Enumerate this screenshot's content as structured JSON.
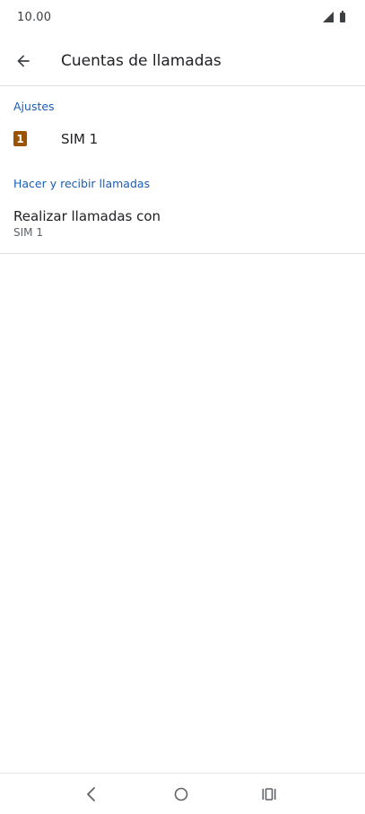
{
  "status_bar": {
    "time": "10.00",
    "icons": [
      "signal-icon",
      "battery-icon"
    ]
  },
  "app_bar": {
    "back_icon": "arrow-left-icon",
    "title": "Cuentas de llamadas"
  },
  "sections": [
    {
      "header": "Ajustes",
      "items": [
        {
          "badge": "1",
          "title": "SIM 1"
        }
      ]
    },
    {
      "header": "Hacer y recibir llamadas",
      "items": [
        {
          "title": "Realizar llamadas con",
          "subtitle": "SIM 1"
        }
      ]
    }
  ],
  "nav_bar": {
    "buttons": [
      "back-nav-icon",
      "home-nav-icon",
      "recents-nav-icon"
    ]
  },
  "colors": {
    "accent": "#1a5db4",
    "sim_badge": "#9a5300",
    "text_primary": "#202124",
    "text_secondary": "#5f6368"
  }
}
